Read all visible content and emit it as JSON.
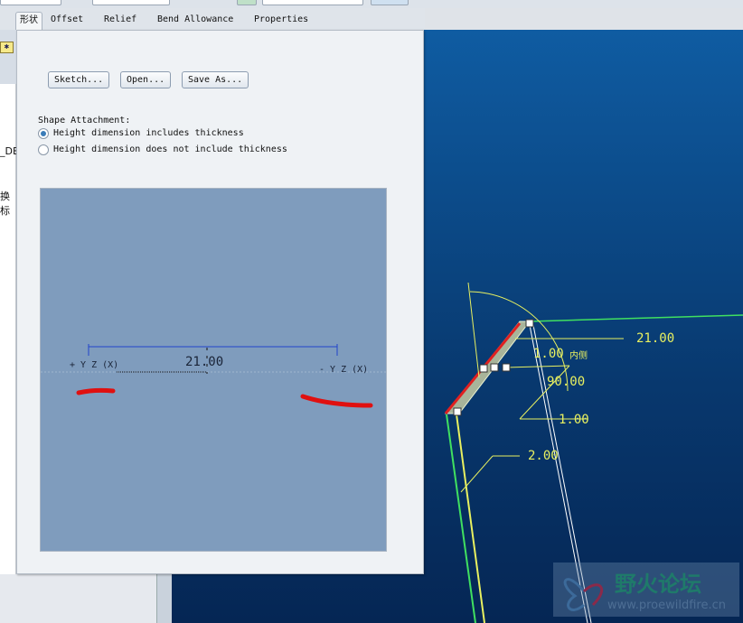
{
  "tabs": [
    {
      "label": "形状",
      "active": true
    },
    {
      "label": "Offset"
    },
    {
      "label": "Relief"
    },
    {
      "label": "Bend Allowance"
    },
    {
      "label": "Properties"
    }
  ],
  "left_strip": {
    "item1": "_DEF",
    "item2": "换 标",
    "folder_icon": "folder-star-icon"
  },
  "buttons": {
    "sketch": "Sketch...",
    "open": "Open...",
    "save_as": "Save As..."
  },
  "shape_attachment": {
    "label": "Shape Attachment:",
    "options": [
      {
        "label": "Height dimension includes thickness",
        "selected": true
      },
      {
        "label": "Height dimension does not include thickness",
        "selected": false
      }
    ]
  },
  "preview": {
    "dimension": "21.00",
    "left_coord": "+ Y Z (X)",
    "right_coord": "- Y Z (X)"
  },
  "viewport": {
    "dim_length": "21.00",
    "dim_thickness": "1.00",
    "dim_side": "内侧",
    "dim_angle": "90.00",
    "dim_radius": "1.00",
    "dim_height": "2.00"
  },
  "watermark": {
    "name": "野火论坛",
    "url": "www.proewildfire.cn"
  },
  "colors": {
    "viewport_bg": "#0a4a8a",
    "dimension": "#e8f060",
    "edge_highlight": "#e02020",
    "wall": "#30d040"
  }
}
